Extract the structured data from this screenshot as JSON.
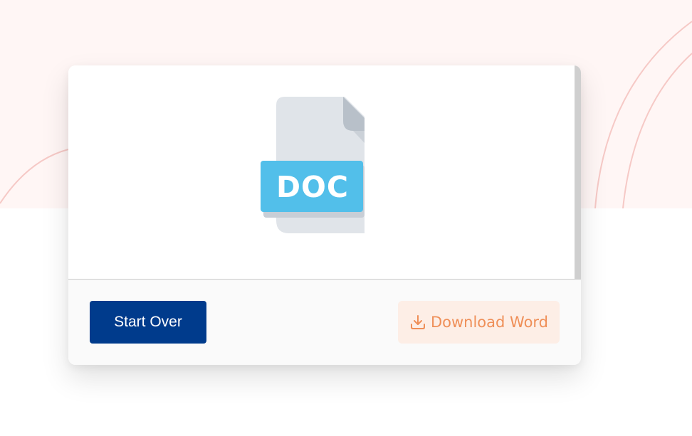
{
  "actions": {
    "start_over_label": "Start Over",
    "download_label": "Download Word",
    "download_icon": "download-icon"
  },
  "preview": {
    "file_type_label": "DOC",
    "file_icon": "doc-file-icon"
  },
  "colors": {
    "primary": "#003b8c",
    "download_text": "#ef8f58",
    "download_bg": "#fdeee6",
    "doc_badge": "#52bfea",
    "hero_bg": "#fff6f5",
    "hero_arc": "#f6c9c6"
  }
}
